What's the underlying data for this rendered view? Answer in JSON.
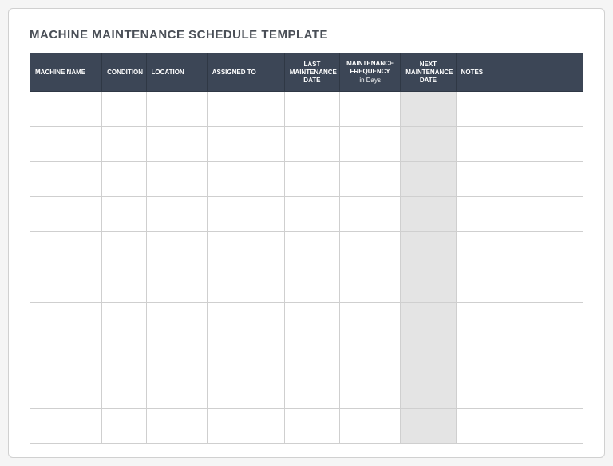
{
  "title": "MACHINE MAINTENANCE SCHEDULE TEMPLATE",
  "columns": {
    "machine_name": "MACHINE NAME",
    "condition": "CONDITION",
    "location": "LOCATION",
    "assigned_to": "ASSIGNED TO",
    "last_maintenance_date": "LAST MAINTENANCE DATE",
    "maintenance_frequency": "MAINTENANCE FREQUENCY",
    "maintenance_frequency_sub": "in Days",
    "next_maintenance_date": "NEXT MAINTENANCE DATE",
    "notes": "NOTES"
  },
  "rows": [
    {
      "machine_name": "",
      "condition": "",
      "location": "",
      "assigned_to": "",
      "last_maintenance_date": "",
      "maintenance_frequency": "",
      "next_maintenance_date": "",
      "notes": ""
    },
    {
      "machine_name": "",
      "condition": "",
      "location": "",
      "assigned_to": "",
      "last_maintenance_date": "",
      "maintenance_frequency": "",
      "next_maintenance_date": "",
      "notes": ""
    },
    {
      "machine_name": "",
      "condition": "",
      "location": "",
      "assigned_to": "",
      "last_maintenance_date": "",
      "maintenance_frequency": "",
      "next_maintenance_date": "",
      "notes": ""
    },
    {
      "machine_name": "",
      "condition": "",
      "location": "",
      "assigned_to": "",
      "last_maintenance_date": "",
      "maintenance_frequency": "",
      "next_maintenance_date": "",
      "notes": ""
    },
    {
      "machine_name": "",
      "condition": "",
      "location": "",
      "assigned_to": "",
      "last_maintenance_date": "",
      "maintenance_frequency": "",
      "next_maintenance_date": "",
      "notes": ""
    },
    {
      "machine_name": "",
      "condition": "",
      "location": "",
      "assigned_to": "",
      "last_maintenance_date": "",
      "maintenance_frequency": "",
      "next_maintenance_date": "",
      "notes": ""
    },
    {
      "machine_name": "",
      "condition": "",
      "location": "",
      "assigned_to": "",
      "last_maintenance_date": "",
      "maintenance_frequency": "",
      "next_maintenance_date": "",
      "notes": ""
    },
    {
      "machine_name": "",
      "condition": "",
      "location": "",
      "assigned_to": "",
      "last_maintenance_date": "",
      "maintenance_frequency": "",
      "next_maintenance_date": "",
      "notes": ""
    },
    {
      "machine_name": "",
      "condition": "",
      "location": "",
      "assigned_to": "",
      "last_maintenance_date": "",
      "maintenance_frequency": "",
      "next_maintenance_date": "",
      "notes": ""
    },
    {
      "machine_name": "",
      "condition": "",
      "location": "",
      "assigned_to": "",
      "last_maintenance_date": "",
      "maintenance_frequency": "",
      "next_maintenance_date": "",
      "notes": ""
    }
  ]
}
